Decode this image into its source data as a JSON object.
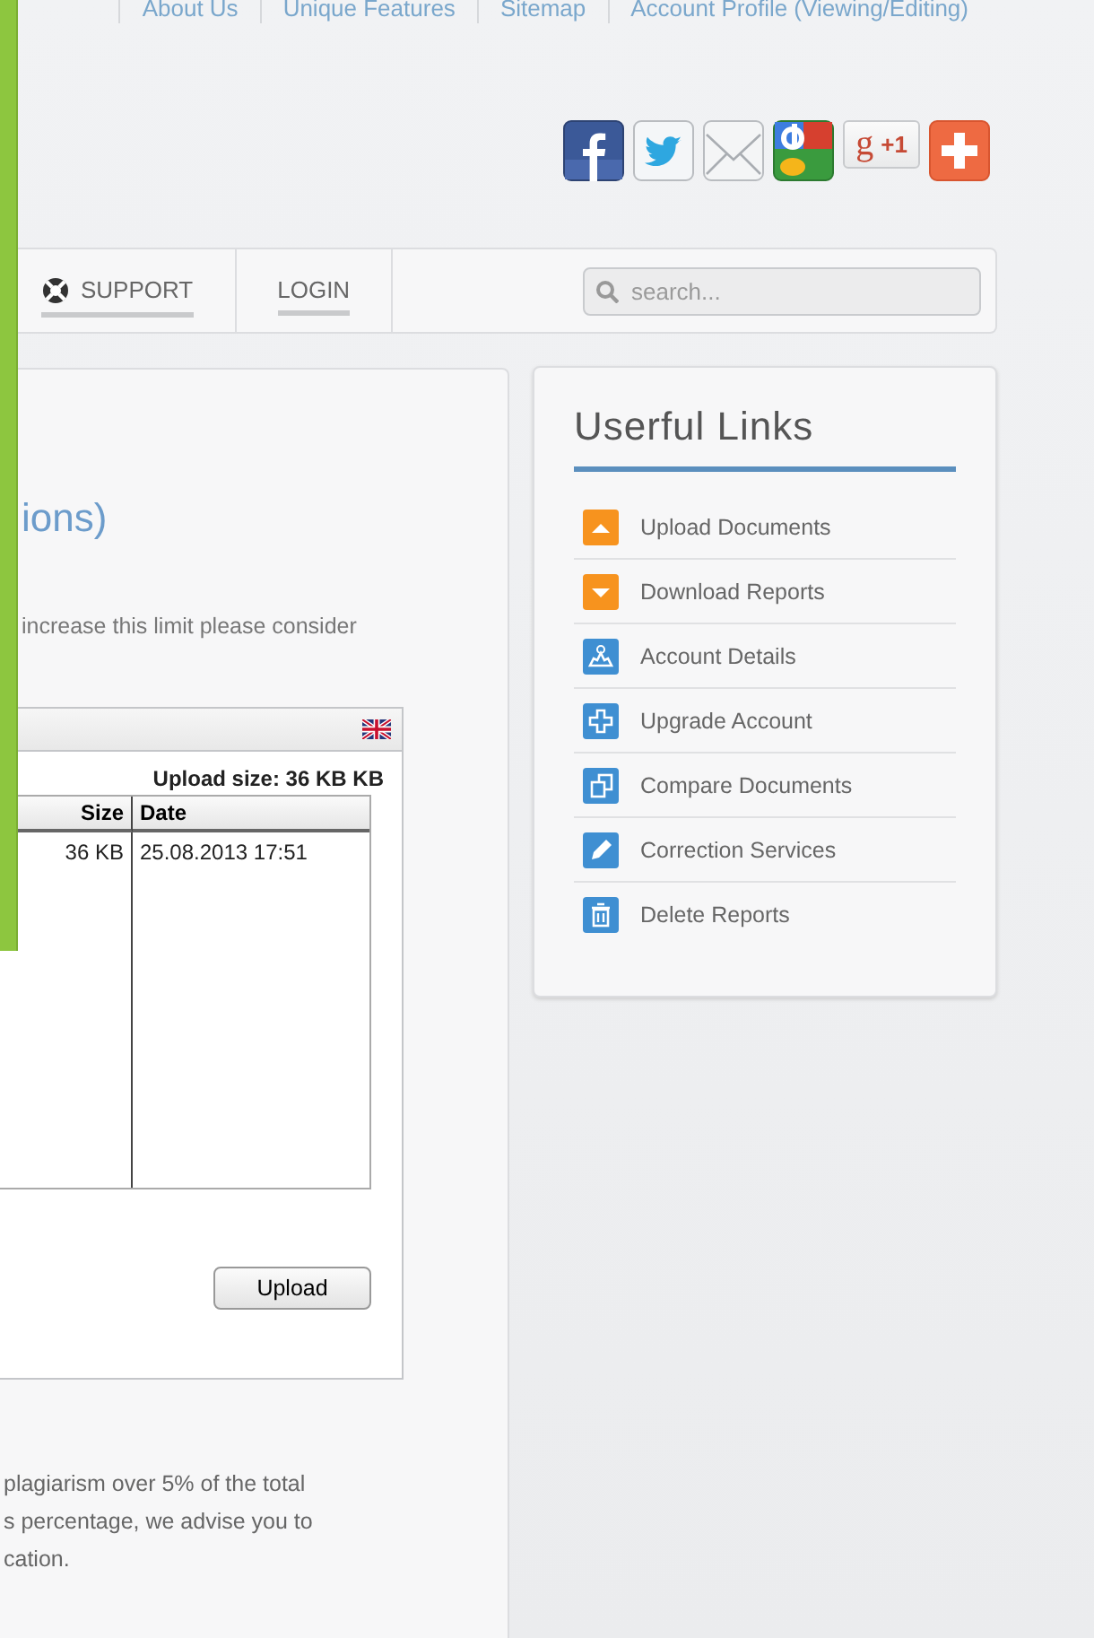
{
  "top_links": [
    {
      "label": "About Us"
    },
    {
      "label": "Unique Features"
    },
    {
      "label": "Sitemap"
    },
    {
      "label": "Account Profile (Viewing/Editing)"
    }
  ],
  "share_buttons": [
    {
      "kind": "f"
    },
    {
      "kind": "bird"
    },
    {
      "kind": "mail"
    },
    {
      "kind": "g"
    },
    {
      "kind": "plusone",
      "letter": "g",
      "label": "+1"
    },
    {
      "kind": "plus"
    }
  ],
  "nav": [
    {
      "label": "SUPPORT"
    },
    {
      "label": "LOGIN"
    }
  ],
  "search": {
    "placeholder": "search..."
  },
  "main": {
    "heading": "ions)",
    "note": "increase this limit please consider",
    "uploader": {
      "size_label": "Upload size: 36 KB KB",
      "columns": [
        "Size",
        "Date"
      ],
      "rows": [
        [
          "36 KB",
          "25.08.2013 17:51"
        ]
      ],
      "button": "Upload"
    },
    "paragraph_lines": [
      "plagiarism over 5% of the total",
      "s percentage, we advise you to",
      "cation."
    ]
  },
  "links_panel": {
    "title": "Userful Links",
    "items": [
      {
        "label": "Upload Documents",
        "color": "#f7931e"
      },
      {
        "label": "Download Reports",
        "color": "#f7931e"
      },
      {
        "label": "Account Details",
        "color": "#3f8fd2"
      },
      {
        "label": "Upgrade Account",
        "color": "#3f8fd2"
      },
      {
        "label": "Compare Documents",
        "color": "#3f8fd2"
      },
      {
        "label": "Correction Services",
        "color": "#3f8fd2"
      },
      {
        "label": "Delete Reports",
        "color": "#3f8fd2"
      }
    ]
  }
}
